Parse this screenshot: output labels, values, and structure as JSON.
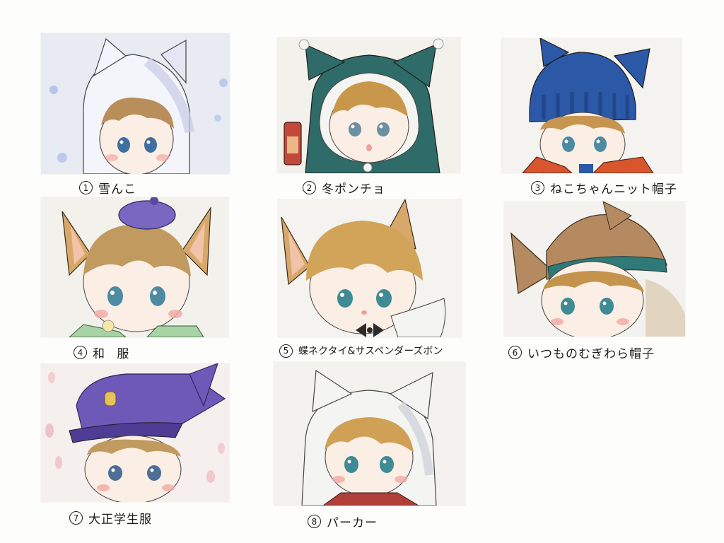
{
  "items": [
    {
      "number": "1",
      "label": "雪んこ",
      "palette": {
        "bg": "#e9ecf2",
        "hat": "#f4f5fa",
        "hat_shade": "#c7cce6",
        "accent": "#9fb4e6",
        "hair": "#b98e5a"
      }
    },
    {
      "number": "2",
      "label": "冬ポンチョ",
      "palette": {
        "bg": "#f2f1ec",
        "hat": "#2f6b68",
        "hat_shade": "#1f4d4b",
        "accent": "#c2483a",
        "hair": "#c9974c"
      }
    },
    {
      "number": "3",
      "label": "ねこちゃんニット帽子",
      "palette": {
        "bg": "#f4f3ef",
        "hat": "#2c58a8",
        "hat_shade": "#1f3f7d",
        "accent": "#d9552e",
        "hair": "#c6954f"
      }
    },
    {
      "number": "4",
      "label": "和 服",
      "palette": {
        "bg": "#f3f1ec",
        "hat": "#7a67c2",
        "hat_shade": "#5b4aa0",
        "accent": "#a7d3a5",
        "hair": "#c09a5e"
      }
    },
    {
      "number": "5",
      "label": "蝶ネクタイ&サスペンダーズボン",
      "palette": {
        "bg": "#f4f3ef",
        "hat": "#d8a86a",
        "hat_shade": "#b9874a",
        "accent": "#2b2b2b",
        "hair": "#d1a45a"
      }
    },
    {
      "number": "6",
      "label": "いつものむぎわら帽子",
      "palette": {
        "bg": "#f3f2ee",
        "hat": "#b58a60",
        "hat_shade": "#8f6a45",
        "accent": "#2f7a78",
        "hair": "#c4944c"
      }
    },
    {
      "number": "7",
      "label": "大正学生服",
      "palette": {
        "bg": "#f5f0ee",
        "hat": "#6f59b8",
        "hat_shade": "#4f3d95",
        "accent": "#f0b7bf",
        "hair": "#c19a60"
      }
    },
    {
      "number": "8",
      "label": "パーカー",
      "palette": {
        "bg": "#f3f2ee",
        "hat": "#f4f4f2",
        "hat_shade": "#cfd3da",
        "accent": "#b2403a",
        "hair": "#d0a055"
      }
    }
  ]
}
